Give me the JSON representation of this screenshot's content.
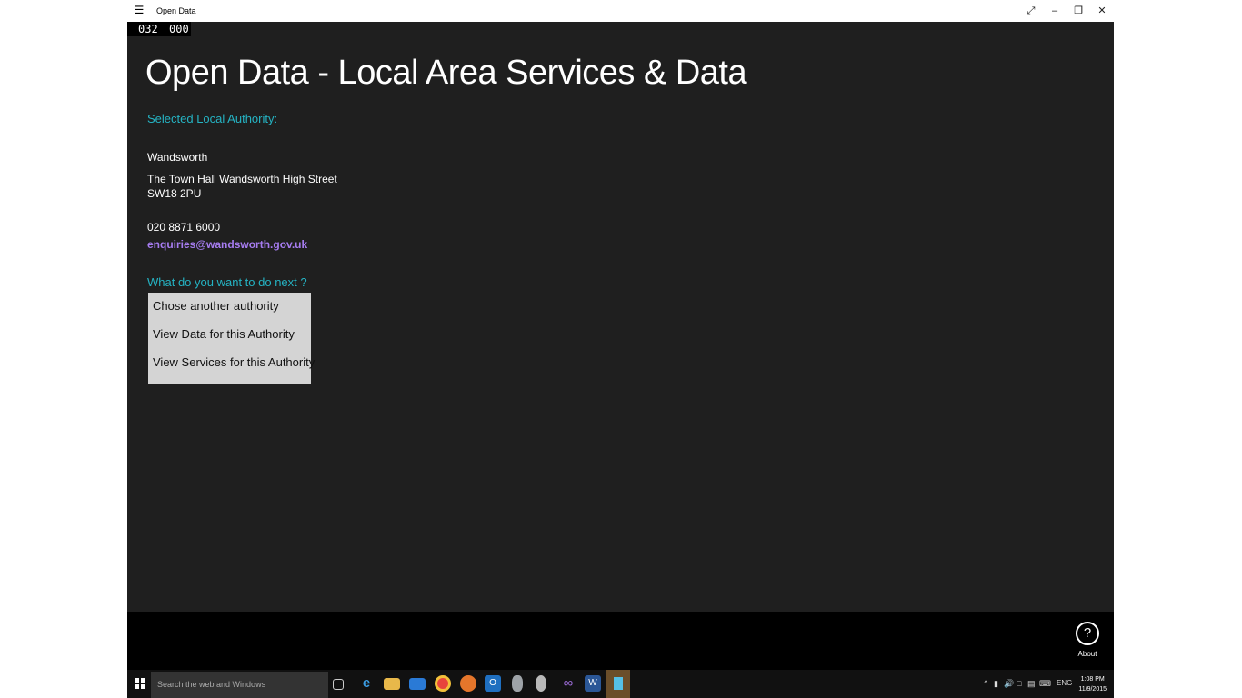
{
  "window": {
    "title": "Open Data",
    "menu_icon": "hamburger-menu-icon",
    "controls": [
      "fullscreen-icon",
      "minimize-icon",
      "restore-icon",
      "close-icon"
    ]
  },
  "fps_counter": {
    "left": "032",
    "right": "000"
  },
  "page": {
    "title": "Open Data - Local Area Services & Data",
    "selected_label": "Selected Local Authority:",
    "authority": {
      "name": "Wandsworth",
      "address_line1": "The Town Hall Wandsworth High Street",
      "address_line2": "SW18 2PU",
      "phone": "020 8871 6000",
      "email": "enquiries@wandsworth.gov.uk"
    },
    "next_label": "What do you want to do next ?",
    "options": [
      "Chose another authority",
      "View Data for this Authority",
      "View Services for this Authority"
    ]
  },
  "app_bar": {
    "about_label": "About",
    "about_icon": "help-question-icon"
  },
  "taskbar": {
    "search_placeholder": "Search the web and Windows",
    "language": "ENG",
    "time": "1:08 PM",
    "date": "11/9/2015"
  },
  "colors": {
    "accent": "#25b3c3",
    "email": "#a67cf0",
    "background": "#1f1f1f",
    "menu_bg": "#d4d4d4"
  }
}
